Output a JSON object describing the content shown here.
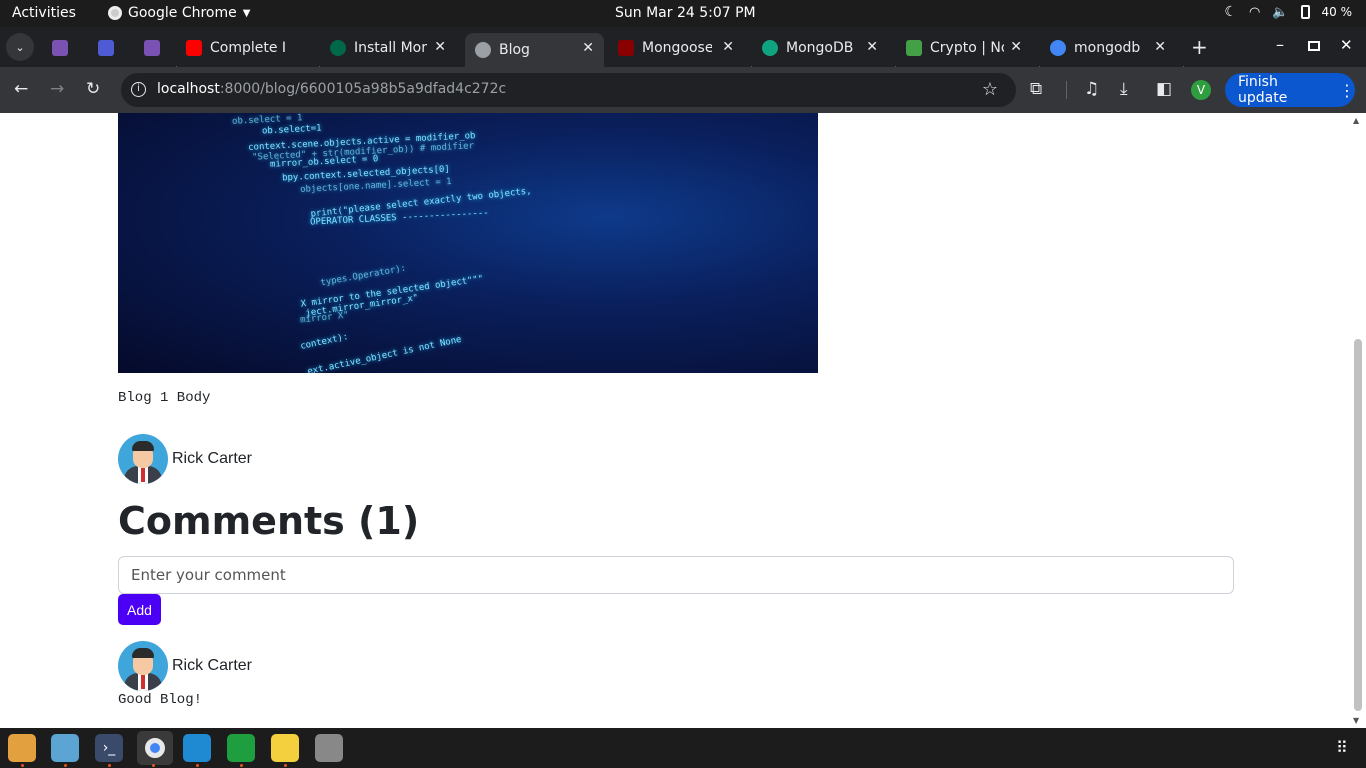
{
  "topbar": {
    "activities": "Activities",
    "app_name": "Google Chrome",
    "clock": "Sun Mar 24  5:07 PM",
    "battery": "40 %"
  },
  "tabs": [
    {
      "title": "Complete I",
      "favicon_color": "#ff0000",
      "icon": "youtube-icon"
    },
    {
      "title": "Install Mor",
      "favicon_color": "#00684a",
      "icon": "mongodb-leaf-icon"
    },
    {
      "title": "Blog",
      "favicon_color": "#9aa0a6",
      "icon": "globe-icon",
      "active": true
    },
    {
      "title": "Mongoose",
      "favicon_color": "#880000",
      "icon": "mongoose-icon"
    },
    {
      "title": "MongoDB",
      "favicon_color": "#10a37f",
      "icon": "chatgpt-icon"
    },
    {
      "title": "Crypto | No",
      "favicon_color": "#43a047",
      "icon": "nodejs-icon"
    },
    {
      "title": "mongodb",
      "favicon_color": "#4285f4",
      "icon": "google-icon"
    }
  ],
  "pinned_tabs": [
    {
      "icon": "bootstrap-icon",
      "color": "#7952b3"
    },
    {
      "icon": "docs-icon",
      "color": "#4f5bd5"
    },
    {
      "icon": "bootstrap-icon",
      "color": "#7952b3"
    }
  ],
  "omnibox": {
    "host": "localhost",
    "path": ":8000/blog/6600105a98b5a9dfad4c272c"
  },
  "toolbar": {
    "profile_initial": "V",
    "update_label": "Finish update",
    "profile_color": "#2e9e3f",
    "update_color": "#0b57d0"
  },
  "post": {
    "body": "Blog 1 Body",
    "author": "Rick Carter",
    "hero_code_lines": [
      "ob.select = 1",
      "ob.select=1",
      "context.scene.objects.active = modifier_ob",
      "\"Selected\" + str(modifier_ob)) # modifier",
      "mirror_ob.select = 0",
      "bpy.context.selected_objects[0]",
      "objects[one.name].select = 1",
      "print(\"please select exactly two objects,",
      "OPERATOR CLASSES ----------------",
      "types.Operator):",
      "X mirror to the selected object\"\"\"",
      "ject.mirror_mirror_x\"",
      "mirror X\"",
      "context):",
      "ext.active_object is not None"
    ]
  },
  "comments": {
    "title": "Comments (1)",
    "input_placeholder": "Enter your comment",
    "add_label": "Add",
    "items": [
      {
        "author": "Rick Carter",
        "text": "Good Blog!"
      }
    ]
  },
  "dock": [
    {
      "icon": "gitlab-icon",
      "color": "#e2a03f"
    },
    {
      "icon": "files-icon",
      "color": "#5ba4d4"
    },
    {
      "icon": "terminal-icon",
      "color": "#3a4a6b"
    },
    {
      "icon": "chrome-icon",
      "color": "#dddddd"
    },
    {
      "icon": "vscode-icon",
      "color": "#1f8ad2"
    },
    {
      "icon": "chat-icon",
      "color": "#1e9e3e"
    },
    {
      "icon": "notes-icon",
      "color": "#f4d03f"
    },
    {
      "icon": "software-icon",
      "color": "#888888"
    }
  ]
}
